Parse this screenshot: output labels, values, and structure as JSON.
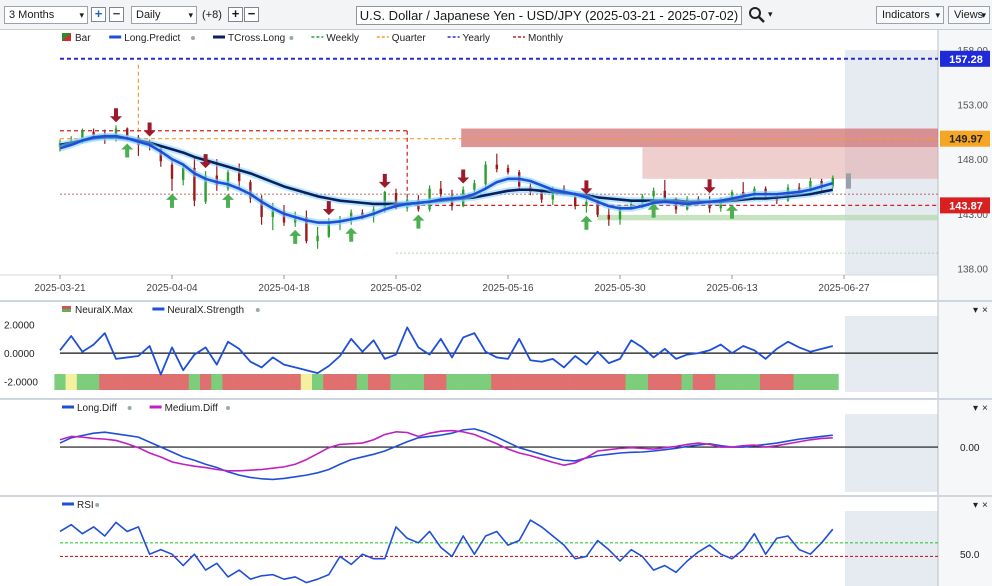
{
  "toolbar": {
    "range": "3 Months",
    "interval": "Daily",
    "offset": "(+8)",
    "title": "U.S. Dollar / Japanese Yen - USD/JPY (2025-03-21 - 2025-07-02)",
    "indicators_label": "Indicators",
    "views_label": "Views",
    "caret": "▾"
  },
  "legend_main": [
    {
      "label": "Bar",
      "kind": "bar",
      "color": "#2e8b2e"
    },
    {
      "label": "Long.Predict",
      "kind": "line",
      "color": "#1f4fd8",
      "dot": true
    },
    {
      "label": "TCross.Long",
      "kind": "line",
      "color": "#0a1f5c",
      "dot": true
    },
    {
      "label": "Weekly",
      "kind": "dash",
      "color": "#2e9e3a"
    },
    {
      "label": "Quarter",
      "kind": "dash",
      "color": "#f0a030"
    },
    {
      "label": "Yearly",
      "kind": "dash",
      "color": "#2a2ad0"
    },
    {
      "label": "Monthly",
      "kind": "dash",
      "color": "#d02020"
    }
  ],
  "legend_neural": [
    {
      "label": "NeuralX.Max",
      "kind": "flag",
      "color": "#d85050"
    },
    {
      "label": "NeuralX.Strength",
      "kind": "line",
      "color": "#1f4fd8",
      "dot": true
    }
  ],
  "legend_diff": [
    {
      "label": "Long.Diff",
      "kind": "line",
      "color": "#1f4fd8",
      "dot": true
    },
    {
      "label": "Medium.Diff",
      "kind": "line",
      "color": "#c020c0",
      "dot": true
    }
  ],
  "legend_rsi": [
    {
      "label": "RSI",
      "kind": "line",
      "color": "#1f4fd8",
      "dot": true
    }
  ],
  "chart_data": [
    {
      "type": "line",
      "title": "",
      "x_tick_labels": [
        "2025-03-21",
        "2025-04-04",
        "2025-04-18",
        "2025-05-02",
        "2025-05-16",
        "2025-05-30",
        "2025-06-13",
        "2025-06-27"
      ],
      "y_tick_labels": [
        "158.00",
        "153.00",
        "148.00",
        "143.00",
        "138.00"
      ],
      "ylim": [
        137.5,
        159
      ],
      "price_labels": [
        {
          "value": "157.28",
          "color": "#1f2ad8"
        },
        {
          "value": "149.97",
          "color": "#f5a623"
        },
        {
          "value": "143.87",
          "color": "#d82020"
        }
      ],
      "levels": {
        "yearly": 157.28,
        "quarter": 149.97,
        "monthly": 143.87
      },
      "candles": [
        [
          149.2,
          149.9,
          148.8,
          149.6
        ],
        [
          149.6,
          150.2,
          149.3,
          149.8
        ],
        [
          149.7,
          150.9,
          149.5,
          150.7
        ],
        [
          150.6,
          150.9,
          150.1,
          150.3
        ],
        [
          150.3,
          150.8,
          149.5,
          150.1
        ],
        [
          150.0,
          151.2,
          149.7,
          150.9
        ],
        [
          150.9,
          151.0,
          149.8,
          150.2
        ],
        [
          150.1,
          150.3,
          148.4,
          149.4
        ],
        [
          149.6,
          149.9,
          148.9,
          149.4
        ],
        [
          149.1,
          149.3,
          147.4,
          147.9
        ],
        [
          147.6,
          148.2,
          145.2,
          146.3
        ],
        [
          146.2,
          147.6,
          145.7,
          147.3
        ],
        [
          147.3,
          148.3,
          143.8,
          144.3
        ],
        [
          144.2,
          147.0,
          144.0,
          146.6
        ],
        [
          146.6,
          148.1,
          145.2,
          145.7
        ],
        [
          145.4,
          147.1,
          145.2,
          146.9
        ],
        [
          146.9,
          147.7,
          145.5,
          146.1
        ],
        [
          146.0,
          146.2,
          144.1,
          144.5
        ],
        [
          144.5,
          144.8,
          142.1,
          142.8
        ],
        [
          142.8,
          144.1,
          141.6,
          143.4
        ],
        [
          143.4,
          143.9,
          142.0,
          142.3
        ],
        [
          142.3,
          143.3,
          141.9,
          142.8
        ],
        [
          142.8,
          143.4,
          140.4,
          140.6
        ],
        [
          140.6,
          141.9,
          139.9,
          141.1
        ],
        [
          141.0,
          142.7,
          140.9,
          142.3
        ],
        [
          142.3,
          142.9,
          141.6,
          142.5
        ],
        [
          142.6,
          143.5,
          142.1,
          143.2
        ],
        [
          143.2,
          143.5,
          142.6,
          142.9
        ],
        [
          142.9,
          143.8,
          142.3,
          143.5
        ],
        [
          143.5,
          145.2,
          143.2,
          145.1
        ],
        [
          145.0,
          145.4,
          143.5,
          143.6
        ],
        [
          143.6,
          144.6,
          143.3,
          144.4
        ],
        [
          144.4,
          144.8,
          143.3,
          143.5
        ],
        [
          143.5,
          145.7,
          143.3,
          145.4
        ],
        [
          145.4,
          146.1,
          144.4,
          144.9
        ],
        [
          144.8,
          145.3,
          143.4,
          143.8
        ],
        [
          143.8,
          145.6,
          143.7,
          145.3
        ],
        [
          145.3,
          146.2,
          144.6,
          145.9
        ],
        [
          145.8,
          147.9,
          145.5,
          147.6
        ],
        [
          147.6,
          148.6,
          146.9,
          147.2
        ],
        [
          147.3,
          147.6,
          146.7,
          146.9
        ],
        [
          146.9,
          147.1,
          145.3,
          145.6
        ],
        [
          145.6,
          145.9,
          144.8,
          145.1
        ],
        [
          145.1,
          145.3,
          144.1,
          144.4
        ],
        [
          144.4,
          145.6,
          143.9,
          145.4
        ],
        [
          145.4,
          145.7,
          144.8,
          145.0
        ],
        [
          145.0,
          145.1,
          143.5,
          143.8
        ],
        [
          143.8,
          144.6,
          143.2,
          144.2
        ],
        [
          144.2,
          144.4,
          142.8,
          143.0
        ],
        [
          143.0,
          143.6,
          142.0,
          142.6
        ],
        [
          142.6,
          143.9,
          142.1,
          143.7
        ],
        [
          143.7,
          144.2,
          143.5,
          144.0
        ],
        [
          143.9,
          144.9,
          143.6,
          144.7
        ],
        [
          144.7,
          145.5,
          144.3,
          145.2
        ],
        [
          145.2,
          146.2,
          144.3,
          144.5
        ],
        [
          144.5,
          144.6,
          143.1,
          143.5
        ],
        [
          143.5,
          144.7,
          143.4,
          144.5
        ],
        [
          144.5,
          144.7,
          143.9,
          144.2
        ],
        [
          144.2,
          144.7,
          143.2,
          143.6
        ],
        [
          143.6,
          144.6,
          143.3,
          144.5
        ],
        [
          144.4,
          145.3,
          144.2,
          145.1
        ],
        [
          145.1,
          146.0,
          144.6,
          144.8
        ],
        [
          144.9,
          145.6,
          144.3,
          145.4
        ],
        [
          145.4,
          145.6,
          144.4,
          144.6
        ],
        [
          144.6,
          145.0,
          144.0,
          144.3
        ],
        [
          144.3,
          145.8,
          144.2,
          145.5
        ],
        [
          145.5,
          145.9,
          144.9,
          145.2
        ],
        [
          145.2,
          146.4,
          145.0,
          146.1
        ],
        [
          146.1,
          146.3,
          145.2,
          145.6
        ],
        [
          145.6,
          146.6,
          145.4,
          146.4
        ]
      ],
      "long_predict": [
        149.1,
        149.4,
        149.8,
        150.1,
        150.2,
        150.2,
        150.0,
        149.7,
        149.4,
        148.8,
        148.1,
        147.6,
        146.8,
        146.3,
        146.0,
        145.8,
        145.4,
        144.9,
        144.2,
        143.6,
        143.1,
        142.8,
        142.5,
        142.3,
        142.3,
        142.4,
        142.6,
        142.8,
        143.1,
        143.5,
        143.8,
        144.0,
        144.1,
        144.2,
        144.4,
        144.5,
        144.6,
        144.9,
        145.4,
        146.0,
        146.3,
        146.3,
        146.1,
        145.7,
        145.3,
        145.1,
        144.9,
        144.6,
        144.2,
        143.8,
        143.6,
        143.6,
        143.8,
        144.1,
        144.2,
        144.1,
        144.0,
        144.1,
        144.2,
        144.3,
        144.5,
        144.7,
        144.9,
        144.9,
        144.9,
        145.0,
        145.1,
        145.3,
        145.6,
        145.9
      ],
      "tcross_long": [
        149.4,
        149.6,
        149.8,
        150.0,
        150.1,
        150.1,
        150.0,
        149.8,
        149.6,
        149.3,
        149.0,
        148.7,
        148.3,
        148.0,
        147.7,
        147.4,
        147.1,
        146.8,
        146.4,
        146.0,
        145.6,
        145.3,
        145.0,
        144.7,
        144.5,
        144.3,
        144.2,
        144.1,
        144.0,
        144.0,
        144.0,
        144.0,
        144.1,
        144.2,
        144.3,
        144.4,
        144.5,
        144.6,
        144.8,
        145.0,
        145.2,
        145.3,
        145.3,
        145.2,
        145.1,
        145.0,
        144.9,
        144.8,
        144.6,
        144.5,
        144.4,
        144.3,
        144.3,
        144.3,
        144.3,
        144.3,
        144.2,
        144.2,
        144.2,
        144.2,
        144.3,
        144.4,
        144.5,
        144.5,
        144.6,
        144.7,
        144.8,
        144.9,
        145.1,
        145.3
      ],
      "up_arrows": [
        6,
        10,
        15,
        21,
        26,
        32,
        47,
        53,
        60
      ],
      "down_arrows": [
        5,
        8,
        13,
        24,
        29,
        36,
        47,
        58
      ],
      "shaded_zones": [
        {
          "name": "supply-zone",
          "y": [
            149.2,
            150.9
          ],
          "from": 36
        },
        {
          "name": "demand-zone",
          "y": [
            142.5,
            143.0
          ],
          "from": 48
        }
      ]
    },
    {
      "type": "line",
      "title": "",
      "series": [
        {
          "name": "NeuralX.Strength"
        }
      ],
      "y_tick_labels": [
        "2.0000",
        "0.0000",
        "-2.0000"
      ],
      "ylim": [
        -2.3,
        2.6
      ],
      "values": [
        0.2,
        1.2,
        0.1,
        0.6,
        1.4,
        -0.4,
        -0.3,
        -0.2,
        0.5,
        -1.5,
        0.4,
        -1.2,
        -0.1,
        0.4,
        -0.8,
        0.8,
        0.3,
        -0.6,
        -1.0,
        -0.3,
        -0.8,
        -1.0,
        -1.2,
        -1.4,
        -0.9,
        -0.2,
        1.0,
        0.1,
        0.9,
        -0.4,
        -0.1,
        1.8,
        0.4,
        -0.1,
        1.0,
        -0.3,
        1.1,
        1.4,
        0.1,
        -0.3,
        -0.4,
        1.0,
        -0.5,
        -0.6,
        -0.4,
        -1.0,
        -0.2,
        -0.8,
        0.1,
        -0.7,
        -0.4,
        0.9,
        0.4,
        -0.3,
        0.3,
        -0.4,
        -0.1,
        0.0,
        0.2,
        0.6,
        0.0,
        0.5,
        0.2,
        -0.4,
        0.3,
        0.8,
        0.4,
        0.1,
        0.3,
        0.5
      ],
      "max_band": [
        "g",
        "y",
        "g",
        "g",
        "r",
        "r",
        "r",
        "r",
        "r",
        "r",
        "r",
        "r",
        "g",
        "r",
        "g",
        "r",
        "r",
        "r",
        "r",
        "r",
        "r",
        "r",
        "y",
        "g",
        "r",
        "r",
        "r",
        "g",
        "r",
        "r",
        "g",
        "g",
        "g",
        "r",
        "r",
        "g",
        "g",
        "g",
        "g",
        "r",
        "r",
        "r",
        "r",
        "r",
        "r",
        "r",
        "r",
        "r",
        "r",
        "r",
        "r",
        "g",
        "g",
        "r",
        "r",
        "r",
        "g",
        "r",
        "r",
        "g",
        "g",
        "g",
        "g",
        "r",
        "r",
        "r",
        "g",
        "g",
        "g",
        "g"
      ],
      "band_colors": {
        "g": "#7ccd7c",
        "r": "#e07070",
        "y": "#f5f0a0"
      }
    },
    {
      "type": "line",
      "title": "",
      "y_tick_labels": [
        "0.00"
      ],
      "ylim": [
        -1.3,
        1.0
      ],
      "series": [
        {
          "name": "Long.Diff",
          "values": [
            0.12,
            0.28,
            0.35,
            0.42,
            0.45,
            0.4,
            0.35,
            0.3,
            0.15,
            0.0,
            -0.15,
            -0.3,
            -0.4,
            -0.52,
            -0.62,
            -0.75,
            -0.85,
            -0.92,
            -0.96,
            -0.98,
            -0.95,
            -0.9,
            -0.85,
            -0.78,
            -0.68,
            -0.52,
            -0.38,
            -0.3,
            -0.22,
            -0.12,
            0.02,
            0.16,
            0.28,
            0.32,
            0.36,
            0.42,
            0.52,
            0.55,
            0.45,
            0.3,
            0.14,
            -0.02,
            -0.12,
            -0.22,
            -0.32,
            -0.4,
            -0.42,
            -0.33,
            -0.26,
            -0.22,
            -0.18,
            -0.16,
            -0.15,
            -0.12,
            -0.08,
            -0.04,
            0.02,
            0.06,
            0.1,
            0.04,
            0.0,
            0.0,
            0.04,
            0.08,
            0.12,
            0.18,
            0.24,
            0.28,
            0.32,
            0.36
          ]
        },
        {
          "name": "Medium.Diff",
          "values": [
            0.22,
            0.32,
            0.3,
            0.26,
            0.24,
            0.2,
            0.1,
            -0.02,
            -0.18,
            -0.3,
            -0.45,
            -0.52,
            -0.58,
            -0.62,
            -0.68,
            -0.72,
            -0.72,
            -0.7,
            -0.68,
            -0.64,
            -0.6,
            -0.52,
            -0.38,
            -0.2,
            -0.02,
            0.08,
            0.1,
            0.12,
            0.22,
            0.38,
            0.46,
            0.44,
            0.32,
            0.42,
            0.48,
            0.5,
            0.46,
            0.38,
            0.24,
            0.1,
            -0.06,
            -0.18,
            -0.26,
            -0.36,
            -0.46,
            -0.55,
            -0.48,
            -0.32,
            -0.12,
            -0.08,
            -0.04,
            -0.02,
            -0.04,
            -0.06,
            -0.02,
            0.02,
            0.08,
            0.12,
            0.08,
            0.0,
            0.0,
            0.04,
            0.06,
            0.0,
            0.04,
            0.1,
            0.16,
            0.22,
            0.26,
            0.28
          ]
        }
      ]
    },
    {
      "type": "line",
      "title": "",
      "series": [
        {
          "name": "RSI"
        }
      ],
      "y_tick_labels": [
        "50.0"
      ],
      "ylim": [
        24,
        90
      ],
      "guide_levels": {
        "green": 62,
        "red": 50
      },
      "values": [
        72,
        78,
        70,
        76,
        68,
        80,
        72,
        76,
        52,
        56,
        52,
        42,
        52,
        38,
        44,
        32,
        38,
        30,
        33,
        34,
        30,
        32,
        27,
        30,
        34,
        50,
        43,
        52,
        48,
        48,
        76,
        66,
        62,
        72,
        58,
        50,
        68,
        52,
        68,
        72,
        60,
        64,
        82,
        76,
        68,
        60,
        48,
        50,
        64,
        56,
        46,
        56,
        50,
        38,
        42,
        36,
        46,
        54,
        60,
        52,
        48,
        56,
        70,
        52,
        66,
        68,
        56,
        52,
        62,
        74
      ]
    }
  ]
}
